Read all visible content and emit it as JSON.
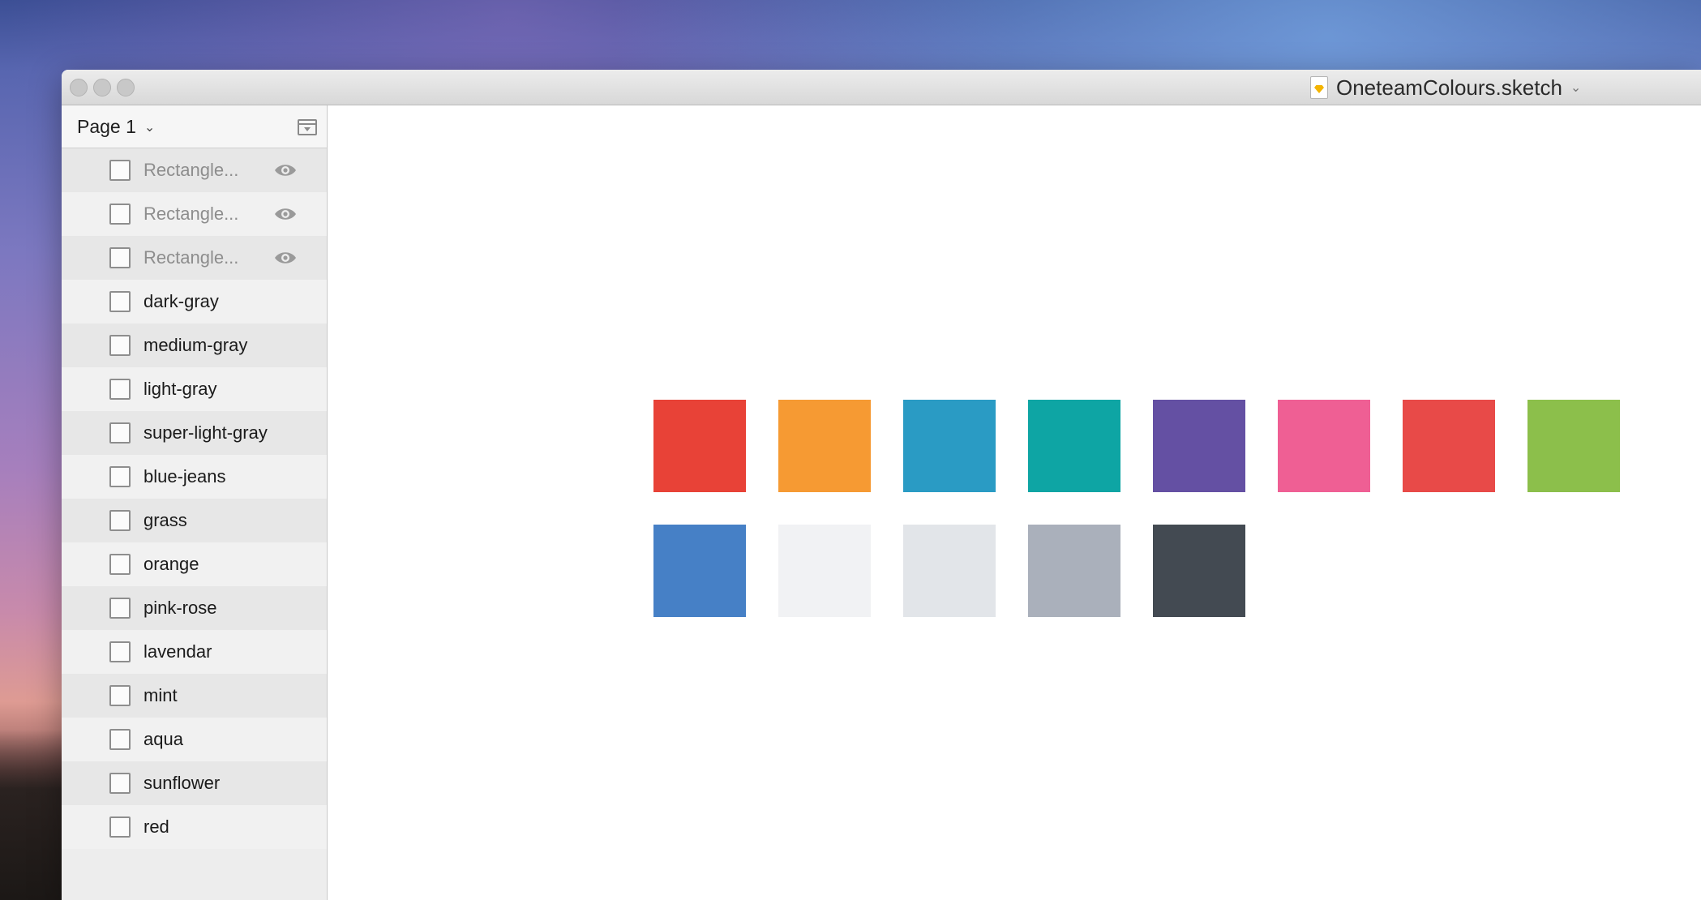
{
  "window": {
    "title": "OneteamColours.sketch",
    "title_caret": "⌄"
  },
  "sidebar": {
    "page_label": "Page 1",
    "page_caret": "⌄",
    "layers": [
      {
        "label": "Rectangle...",
        "hidden": true
      },
      {
        "label": "Rectangle...",
        "hidden": true
      },
      {
        "label": "Rectangle...",
        "hidden": true
      },
      {
        "label": "dark-gray",
        "hidden": false
      },
      {
        "label": "medium-gray",
        "hidden": false
      },
      {
        "label": "light-gray",
        "hidden": false
      },
      {
        "label": "super-light-gray",
        "hidden": false
      },
      {
        "label": "blue-jeans",
        "hidden": false
      },
      {
        "label": "grass",
        "hidden": false
      },
      {
        "label": "orange",
        "hidden": false
      },
      {
        "label": "pink-rose",
        "hidden": false
      },
      {
        "label": "lavendar",
        "hidden": false
      },
      {
        "label": "mint",
        "hidden": false
      },
      {
        "label": "aqua",
        "hidden": false
      },
      {
        "label": "sunflower",
        "hidden": false
      },
      {
        "label": "red",
        "hidden": false
      }
    ]
  },
  "canvas": {
    "swatch_rows": [
      [
        "#e84237",
        "#f69a33",
        "#2a9bc4",
        "#0ea5a4",
        "#6450a3",
        "#ef5f94",
        "#e84a48",
        "#8cbf4b"
      ],
      [
        "#4680c6",
        "#f1f2f4",
        "#e2e5e9",
        "#aab0bb",
        "#434a52"
      ]
    ]
  },
  "colors": {
    "traffic_light": "#c8c8c8",
    "accent_doc_icon": "#f4b400",
    "hidden_text": "#8d8d8d"
  }
}
